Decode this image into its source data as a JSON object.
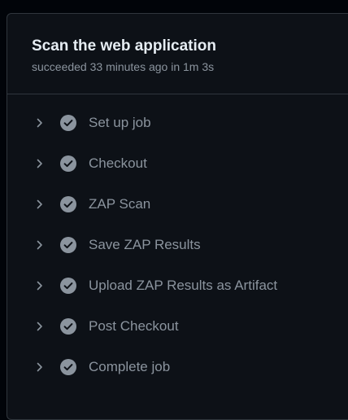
{
  "job": {
    "title": "Scan the web application",
    "status_text": "succeeded 33 minutes ago in 1m 3s"
  },
  "steps": [
    {
      "label": "Set up job",
      "status": "success"
    },
    {
      "label": "Checkout",
      "status": "success"
    },
    {
      "label": "ZAP Scan",
      "status": "success"
    },
    {
      "label": "Save ZAP Results",
      "status": "success"
    },
    {
      "label": "Upload ZAP Results as Artifact",
      "status": "success"
    },
    {
      "label": "Post Checkout",
      "status": "success"
    },
    {
      "label": "Complete job",
      "status": "success"
    }
  ],
  "icons": {
    "expand": "chevron-right-icon",
    "status": "check-circle-fill-icon"
  },
  "colors": {
    "background": "#010409",
    "panel": "#0d1117",
    "title": "#e6edf3",
    "muted_text": "#8b949e",
    "border": "#30363d"
  }
}
